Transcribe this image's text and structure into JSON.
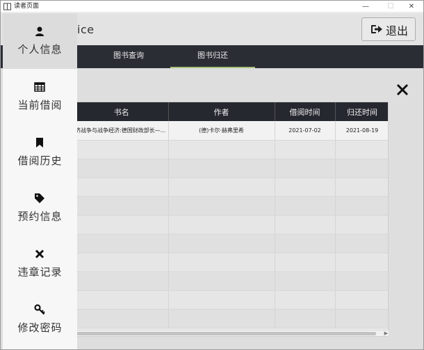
{
  "window": {
    "title": "读者页面",
    "minimize": "—",
    "maximize": "☐",
    "close": "✕"
  },
  "header": {
    "brand": "ice",
    "logout_label": "退出"
  },
  "tabs": [
    {
      "label": "图书查询"
    },
    {
      "label": "图书归还"
    }
  ],
  "sidebar": {
    "items": [
      {
        "label": "个人信息",
        "icon": "user-icon"
      },
      {
        "label": "当前借阅",
        "icon": "table-icon"
      },
      {
        "label": "借阅历史",
        "icon": "bookmark-icon"
      },
      {
        "label": "预约信息",
        "icon": "tag-icon"
      },
      {
        "label": "违章记录",
        "icon": "close-icon"
      },
      {
        "label": "修改密码",
        "icon": "key-icon"
      }
    ]
  },
  "table": {
    "headers": [
      "书名",
      "作者",
      "借阅时间",
      "归还时间"
    ],
    "rows": [
      [
        "济战争与战争经济:德国财政部长—...",
        "(德)卡尔·赫弗里希",
        "2021-07-02",
        "2021-08-19"
      ]
    ]
  },
  "colors": {
    "dark_bar": "#2b2d35",
    "tab_underline": "#a8c27a",
    "sidebar_active": "#dcdcdc"
  }
}
